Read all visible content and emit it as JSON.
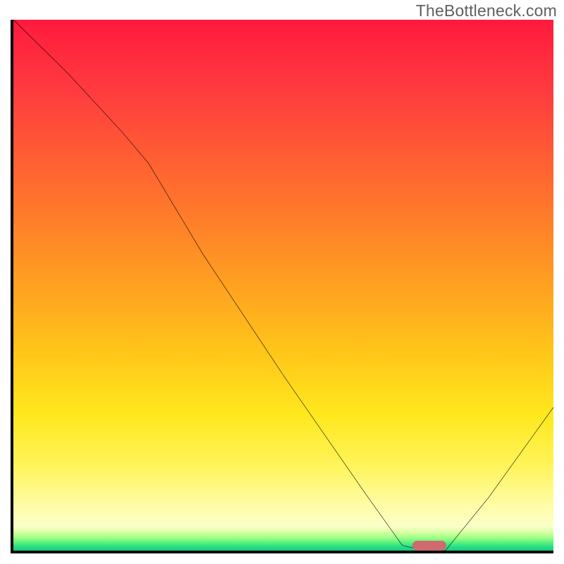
{
  "watermark": "TheBottleneck.com",
  "chart_data": {
    "type": "line",
    "title": "",
    "xlabel": "",
    "ylabel": "",
    "xlim": [
      0,
      100
    ],
    "ylim": [
      0,
      100
    ],
    "grid": false,
    "legend": false,
    "series": [
      {
        "name": "bottleneck-curve",
        "x": [
          0,
          10,
          20,
          25,
          35,
          50,
          65,
          72,
          76,
          80,
          88,
          100
        ],
        "y": [
          100,
          90,
          79,
          73,
          56,
          33,
          11,
          1,
          0,
          0,
          10,
          27
        ]
      }
    ],
    "gradient_stops": {
      "top_color": "#ff1a3e",
      "mid_color": "#ffe81e",
      "bottom_color": "#17cf8a"
    },
    "marker": {
      "name": "optimal-range",
      "x_center_pct": 77,
      "y_pct": 0.5,
      "color": "#cf6a6e"
    }
  }
}
